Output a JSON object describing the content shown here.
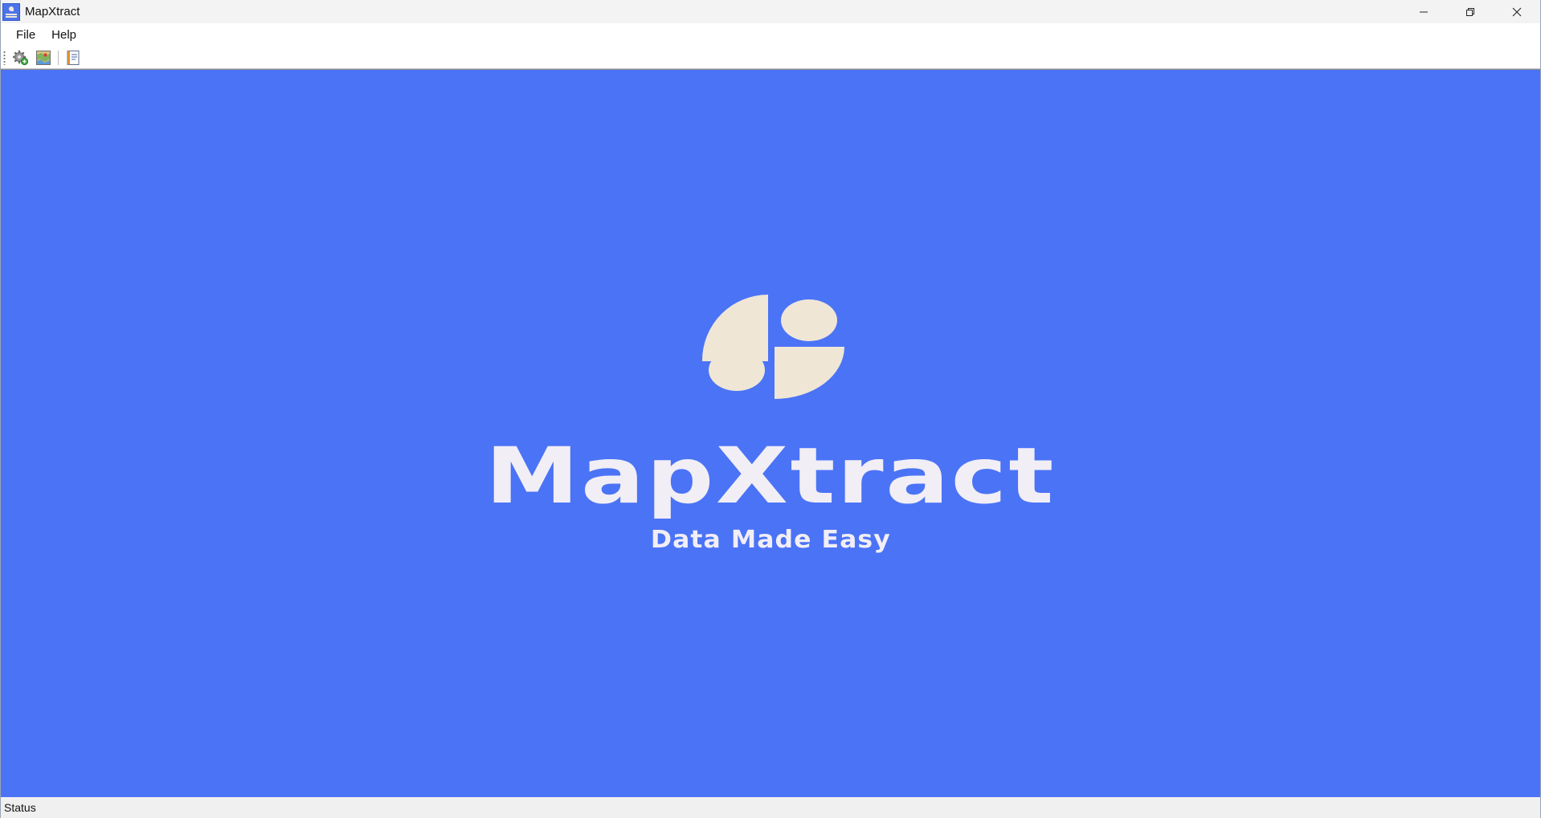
{
  "window": {
    "title": "MapXtract",
    "app_icon": "mapxtract-app-icon",
    "controls": [
      "minimize-icon",
      "restore-icon",
      "close-icon"
    ]
  },
  "menu": {
    "items": [
      {
        "label": "File"
      },
      {
        "label": "Help"
      }
    ]
  },
  "toolbar": {
    "buttons": [
      {
        "icon": "settings-gear-icon"
      },
      {
        "icon": "map-icon"
      },
      {
        "icon": "document-icon"
      }
    ]
  },
  "splash": {
    "brand": "MapXtract",
    "tagline": "Data Made Easy",
    "background_color": "#4b73f6",
    "logo_color": "#efe6d6"
  },
  "statusbar": {
    "text": "Status"
  }
}
